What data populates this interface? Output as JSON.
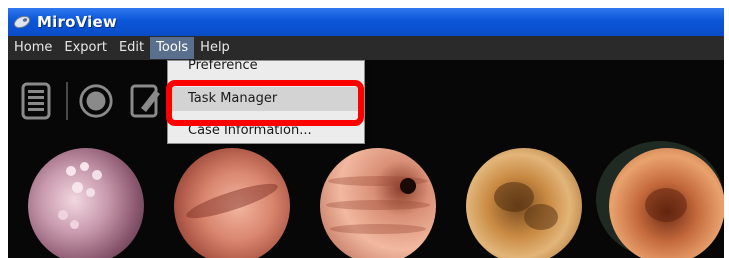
{
  "app": {
    "title": "MiroView"
  },
  "menu": {
    "items": [
      "Home",
      "Export",
      "Edit",
      "Tools",
      "Help"
    ],
    "active": "Tools"
  },
  "toolbar": {
    "icons": [
      "list-icon",
      "record-icon",
      "edit-icon"
    ]
  },
  "dropdown": {
    "items": [
      {
        "label": "Preference",
        "state": "partially-hidden"
      },
      {
        "label": "Task Manager",
        "state": "highlighted"
      },
      {
        "label": "Case Information...",
        "state": "partially-hidden"
      }
    ],
    "callout_color": "#ff0000"
  },
  "thumbnails": {
    "count": 5,
    "selected_index": 4
  },
  "colors": {
    "titlebar": "#0b56d8",
    "menubar": "#2a2a2a",
    "background": "#070707",
    "menu_active": "#5a6f8e",
    "dropdown_bg": "#ececec",
    "highlight_row": "#d3d3d3"
  }
}
